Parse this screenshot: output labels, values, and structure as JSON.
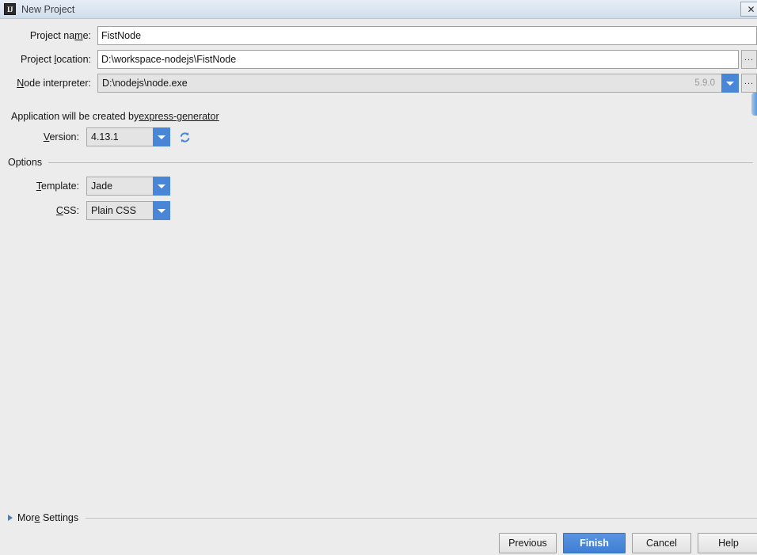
{
  "window": {
    "title": "New Project",
    "app_icon": "intellij-idea-icon",
    "close_icon": "close-icon"
  },
  "form": {
    "project_name": {
      "label": "Project name:",
      "mnemonic": "n",
      "value": "FistNode"
    },
    "project_location": {
      "label": "Project location:",
      "mnemonic": "l",
      "value": "D:\\workspace-nodejs\\FistNode",
      "browse_label": "..."
    },
    "node_interpreter": {
      "label": "Node interpreter:",
      "mnemonic": "N",
      "value": "D:\\nodejs\\node.exe",
      "version_hint": "5.9.0",
      "browse_label": "...",
      "dropdown_icon": "chevron-down-icon"
    },
    "generator_note": {
      "prefix": "Application will be created by ",
      "link_text": "express-generator"
    },
    "version": {
      "label": "Version:",
      "mnemonic": "V",
      "value": "4.13.1",
      "dropdown_icon": "chevron-down-icon",
      "refresh_icon": "refresh-icon"
    }
  },
  "options": {
    "group_title": "Options",
    "template": {
      "label": "Template:",
      "mnemonic": "T",
      "value": "Jade",
      "dropdown_icon": "chevron-down-icon"
    },
    "css": {
      "label": "CSS:",
      "mnemonic": "C",
      "value": "Plain CSS",
      "dropdown_icon": "chevron-down-icon"
    }
  },
  "more_settings": {
    "label": "More Settings",
    "mnemonic": "e",
    "expand_icon": "chevron-right-icon",
    "expanded": false
  },
  "buttons": {
    "previous": "Previous",
    "finish": "Finish",
    "cancel": "Cancel",
    "help": "Help"
  },
  "colors": {
    "accent": "#4a86d8",
    "default_button": "#3f7fd4",
    "background": "#ececec",
    "titlebar": "#dbe5f0"
  }
}
